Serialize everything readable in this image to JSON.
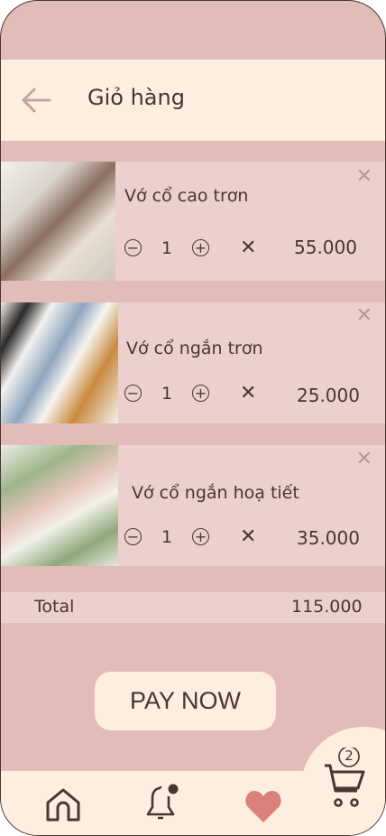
{
  "header": {
    "title": "Giỏ hàng",
    "back_icon": "arrow-left-icon"
  },
  "items": [
    {
      "name": "Vớ cổ cao trơn",
      "qty": "1",
      "price": "55.000"
    },
    {
      "name": "Vớ cổ ngắn trơn",
      "qty": "1",
      "price": "25.000"
    },
    {
      "name": "Vớ cổ ngắn hoạ tiết",
      "qty": "1",
      "price": "35.000"
    }
  ],
  "summary": {
    "total_label": "Total",
    "total_value": "115.000"
  },
  "pay_label": "PAY NOW",
  "nav": {
    "cart_count": "2",
    "items": [
      "home-icon",
      "bell-icon",
      "heart-icon",
      "cart-icon"
    ]
  },
  "colors": {
    "background": "#e2bcb7",
    "surface": "#fdeee0",
    "card": "#ecd0cd",
    "text": "#4a3530",
    "heart": "#d9817a"
  }
}
